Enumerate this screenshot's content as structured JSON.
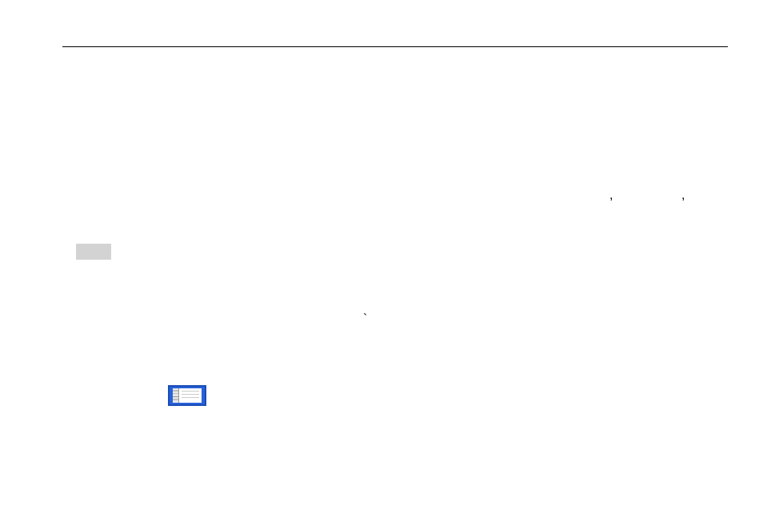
{
  "marks": {
    "accent1": ",",
    "accent2": ",",
    "accent3": "`"
  }
}
